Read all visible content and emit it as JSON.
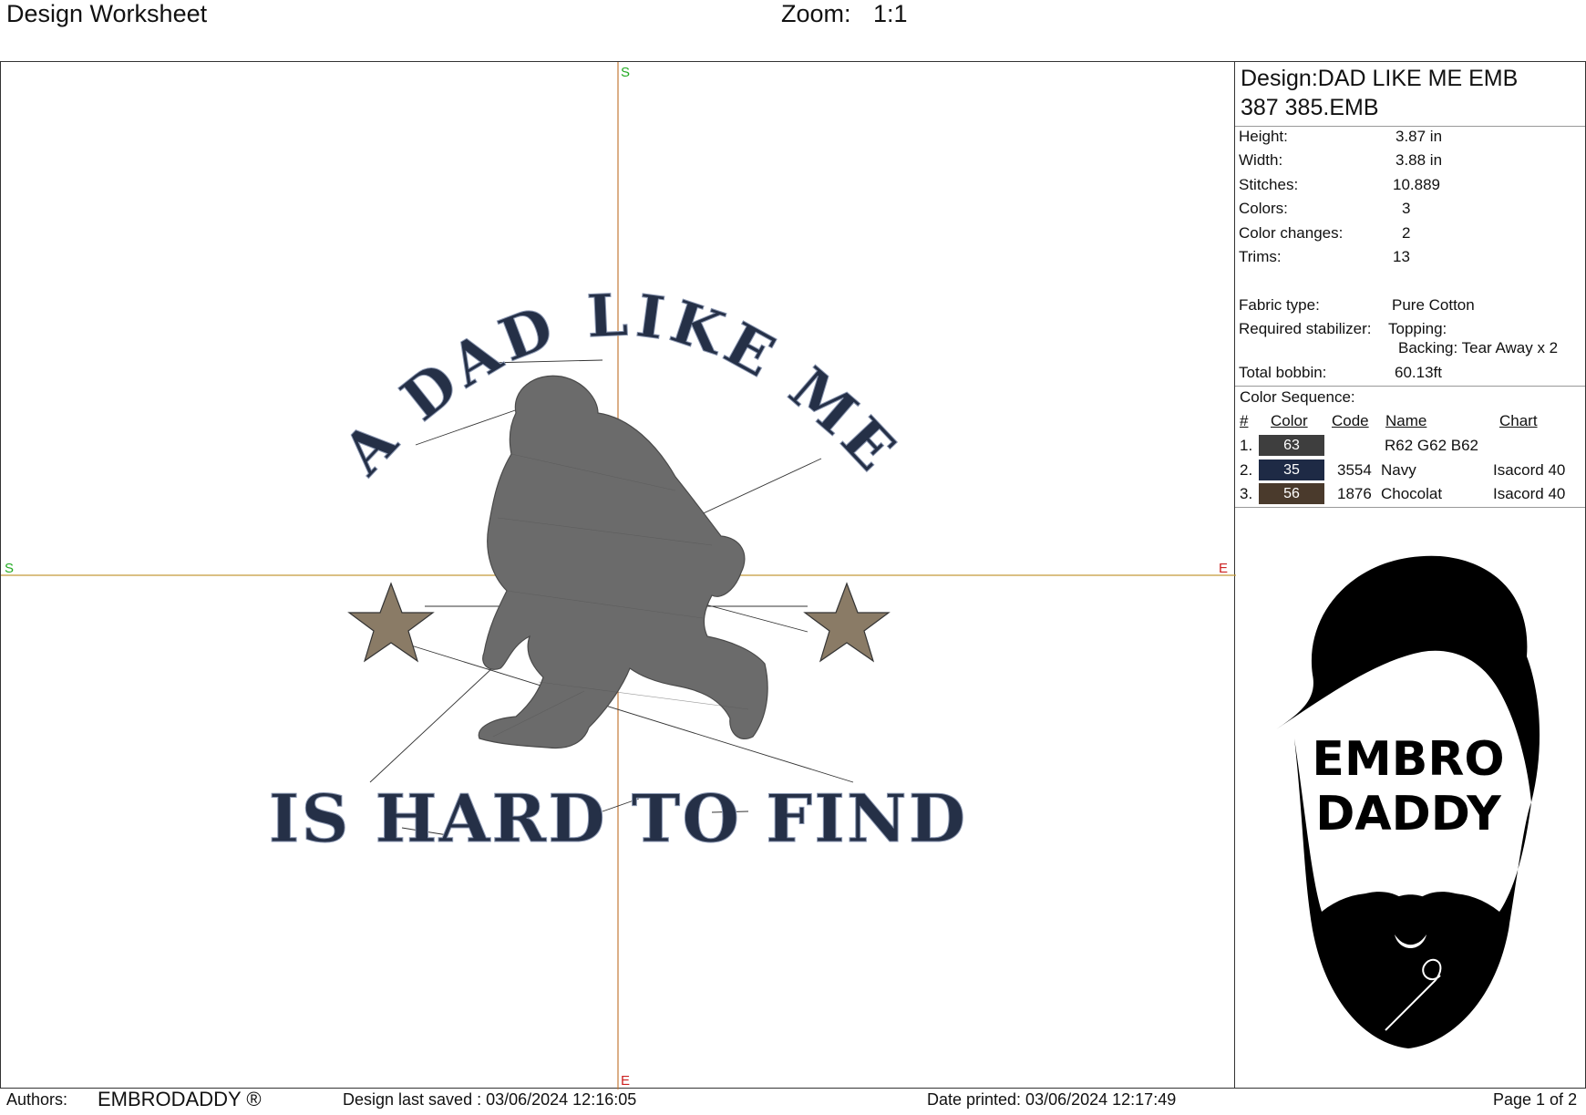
{
  "header": {
    "title": "Design Worksheet",
    "zoom_label": "Zoom:",
    "zoom_value": "1:1"
  },
  "canvas": {
    "marker_top": "S",
    "marker_left": "S",
    "marker_right": "E",
    "marker_bottom": "E",
    "text_top": "A DAD LIKE ME",
    "text_bottom": "IS HARD TO FIND",
    "text_color": "#253047",
    "figure_color": "#6b6b6b",
    "star_color": "#8a7b66",
    "axis_color": "#c47a3a"
  },
  "design": {
    "name_line1": "Design:DAD LIKE ME EMB",
    "name_line2": "387 385.EMB",
    "stats": [
      {
        "label": "Height:",
        "value": "3.87 in"
      },
      {
        "label": "Width:",
        "value": "3.88 in"
      },
      {
        "label": "Stitches:",
        "value": "10.889"
      },
      {
        "label": "Colors:",
        "value": "3"
      },
      {
        "label": "Color changes:",
        "value": "2"
      },
      {
        "label": "Trims:",
        "value": "13"
      }
    ],
    "fabric_label": "Fabric type:",
    "fabric_value": "Pure Cotton",
    "stabilizer_label": "Required stabilizer:",
    "topping": "Topping:",
    "backing": "Backing: Tear Away x 2",
    "bobbin_label": "Total bobbin:",
    "bobbin_value": "60.13ft"
  },
  "color_sequence": {
    "title": "Color Sequence:",
    "headers": {
      "num": "#",
      "color": "Color",
      "code": "Code",
      "name": "Name",
      "chart": "Chart"
    },
    "rows": [
      {
        "num": "1.",
        "swatch": "63",
        "hex": "#3e3e3e",
        "code": "",
        "name": "R62 G62 B62",
        "chart": ""
      },
      {
        "num": "2.",
        "swatch": "35",
        "hex": "#1e2a45",
        "code": "3554",
        "name": "Navy",
        "chart": "Isacord 40"
      },
      {
        "num": "3.",
        "swatch": "56",
        "hex": "#4a3a2c",
        "code": "1876",
        "name": "Chocolat",
        "chart": "Isacord 40"
      }
    ]
  },
  "logo": {
    "line1": "EMBRO",
    "line2": "DADDY"
  },
  "footer": {
    "authors_label": "Authors:",
    "authors_value": "EMBRODADDY ®",
    "saved": "Design last saved : 03/06/2024 12:16:05",
    "printed": "Date printed: 03/06/2024 12:17:49",
    "page": "Page 1 of 2"
  }
}
